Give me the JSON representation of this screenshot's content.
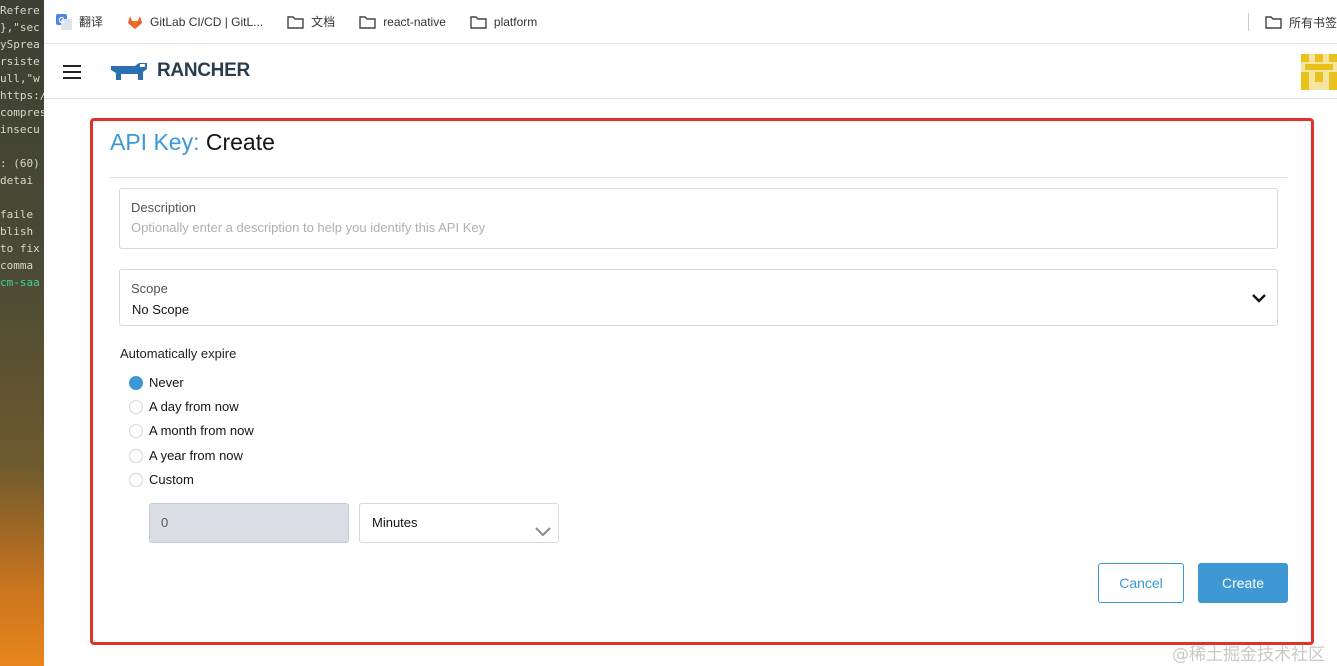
{
  "terminal": {
    "lines": [
      "Refere",
      "},\"sec",
      "ySprea",
      "rsiste",
      "ull,\"w",
      "https:/",
      "compres",
      "insecu",
      "",
      ": (60)",
      " detai",
      "",
      " faile",
      "blish ",
      "to fix",
      " comma",
      "cm-saa"
    ]
  },
  "bookmarks": {
    "items": [
      {
        "label": "翻译",
        "icon": "google-translate-icon"
      },
      {
        "label": "GitLab CI/CD | GitL...",
        "icon": "gitlab-icon"
      },
      {
        "label": "文档",
        "icon": "folder-icon"
      },
      {
        "label": "react-native",
        "icon": "folder-icon"
      },
      {
        "label": "platform",
        "icon": "folder-icon"
      }
    ],
    "other_label": "所有书签"
  },
  "header": {
    "logo_text": "RANCHER",
    "menu_icon": "hamburger-menu-icon",
    "avatar_icon": "user-avatar-icon"
  },
  "page": {
    "breadcrumb": "API Key:",
    "title": "Create"
  },
  "form": {
    "description": {
      "label": "Description",
      "placeholder": "Optionally enter a description to help you identify this API Key"
    },
    "scope": {
      "label": "Scope",
      "value": "No Scope"
    },
    "expire": {
      "label": "Automatically expire",
      "options": [
        {
          "label": "Never",
          "selected": true
        },
        {
          "label": "A day from now",
          "selected": false
        },
        {
          "label": "A month from now",
          "selected": false
        },
        {
          "label": "A year from now",
          "selected": false
        },
        {
          "label": "Custom",
          "selected": false
        }
      ],
      "custom_value": "0",
      "custom_unit": "Minutes"
    }
  },
  "actions": {
    "cancel_label": "Cancel",
    "create_label": "Create"
  },
  "colors": {
    "accent": "#3d98d3",
    "highlight_border": "#e0322b"
  },
  "watermark": "@稀土掘金技术社区"
}
